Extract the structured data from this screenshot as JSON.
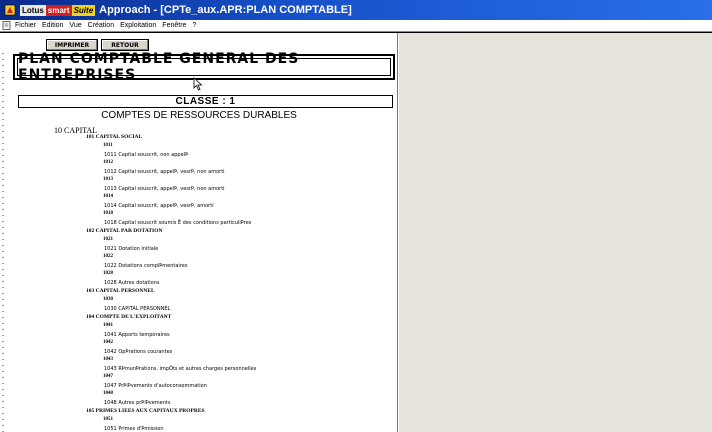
{
  "window": {
    "brand_parts": [
      "Lotus",
      "smart",
      "Suite"
    ],
    "title": "Approach - [CPTe_aux.APR:PLAN COMPTABLE]"
  },
  "menu": {
    "items": [
      "Fichier",
      "Edition",
      "Vue",
      "Création",
      "Exploitation",
      "Fenêtre",
      "?"
    ]
  },
  "toolbar": {
    "print_label": "IMPRIMER",
    "back_label": "RETOUR"
  },
  "report": {
    "main_title": "PLAN COMPTABLE GENERAL DES ENTREPRISES",
    "classe_label": "CLASSE  : 1",
    "section_title": "COMPTES DE RESSOURCES DURABLES",
    "category": "10 CAPITAL",
    "lines": [
      {
        "kind": "head",
        "text": "101 CAPITAL SOCIAL"
      },
      {
        "kind": "code",
        "text": "1011"
      },
      {
        "kind": "desc",
        "text": "1011 Capital souscrit, non appelÞ"
      },
      {
        "kind": "code",
        "text": "1012"
      },
      {
        "kind": "desc",
        "text": "1012 Capital souscrit, appelÞ, vesrÞ, non amorti"
      },
      {
        "kind": "code",
        "text": "1013"
      },
      {
        "kind": "desc",
        "text": "1013 Capital souscrit, appelÞ, vesrÞ, non amorti"
      },
      {
        "kind": "code",
        "text": "1014"
      },
      {
        "kind": "desc",
        "text": "1014 Capital souscrit, appelÞ, vesrÞ, amorti"
      },
      {
        "kind": "code",
        "text": "1018"
      },
      {
        "kind": "desc",
        "text": "1018 Capital souscrit soumis Ê des conditions particuliÞres"
      },
      {
        "kind": "head",
        "text": "102 CAPITAL PAR DOTATION"
      },
      {
        "kind": "code",
        "text": "1021"
      },
      {
        "kind": "desc",
        "text": "1021 Dotation initiale"
      },
      {
        "kind": "code",
        "text": "1022"
      },
      {
        "kind": "desc",
        "text": "1022 Dotations complÞmentaires"
      },
      {
        "kind": "code",
        "text": "1028"
      },
      {
        "kind": "desc",
        "text": "1028 Autres dotations"
      },
      {
        "kind": "head",
        "text": "103 CAPITAL PERSONNEL"
      },
      {
        "kind": "code",
        "text": "1030"
      },
      {
        "kind": "desc",
        "text": "1030 CAPITAL PERSONNEL"
      },
      {
        "kind": "head",
        "text": "104 COMPTE DE L'EXPLOITANT"
      },
      {
        "kind": "code",
        "text": "1041"
      },
      {
        "kind": "desc",
        "text": "1041 Apports temporaires"
      },
      {
        "kind": "code",
        "text": "1042"
      },
      {
        "kind": "desc",
        "text": "1042 OpÞrations courantes"
      },
      {
        "kind": "code",
        "text": "1043"
      },
      {
        "kind": "desc",
        "text": "1043 RÞmunÞrations, impÔts et autres charges personnelles"
      },
      {
        "kind": "code",
        "text": "1047"
      },
      {
        "kind": "desc",
        "text": "1047 PrÞlÞvements d'autoconsommation"
      },
      {
        "kind": "code",
        "text": "1048"
      },
      {
        "kind": "desc",
        "text": "1048 Autres prÞlÞvements"
      },
      {
        "kind": "head",
        "text": "105 PRIMES LIEES AUX CAPITAUX PROPRES"
      },
      {
        "kind": "code",
        "text": "1051"
      },
      {
        "kind": "desc",
        "text": "1051 Primes d'Þmission"
      }
    ]
  },
  "colors": {
    "titlebar": "#1550c8",
    "right_pane": "#e6e3da"
  }
}
